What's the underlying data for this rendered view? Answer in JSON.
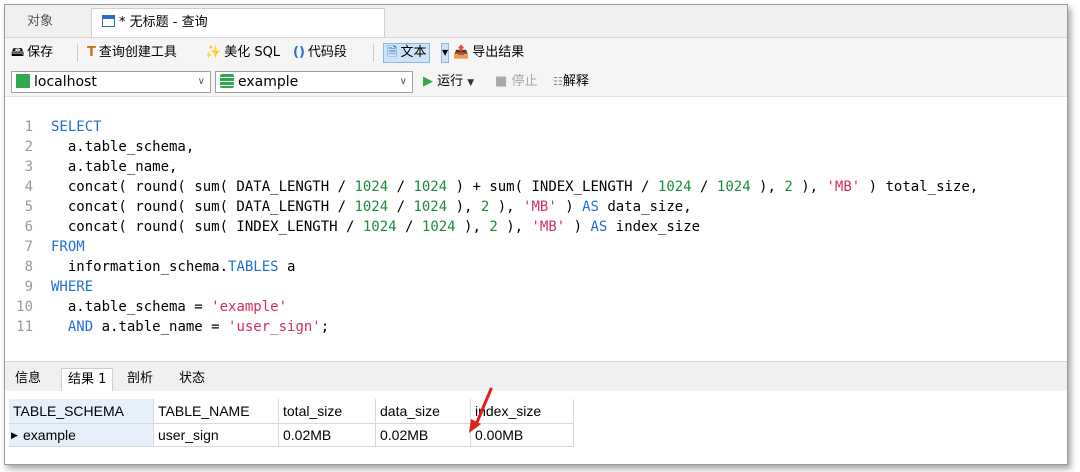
{
  "tabs": {
    "objects": "对象",
    "query": "* 无标题 - 查询"
  },
  "toolbar": {
    "save": "保存",
    "query_builder": "查询创建工具",
    "beautify": "美化 SQL",
    "snippet": "代码段",
    "text": "文本",
    "export": "导出结果"
  },
  "connection": {
    "host": "localhost",
    "database": "example",
    "run": "运行",
    "stop": "停止",
    "explain": "解释"
  },
  "editor": {
    "lines": [
      {
        "n": "1"
      },
      {
        "n": "2"
      },
      {
        "n": "3"
      },
      {
        "n": "4"
      },
      {
        "n": "5"
      },
      {
        "n": "6"
      },
      {
        "n": "7"
      },
      {
        "n": "8"
      },
      {
        "n": "9"
      },
      {
        "n": "10"
      },
      {
        "n": "11"
      }
    ],
    "t": {
      "select": "SELECT",
      "l2": "  a.table_schema,",
      "l3": "  a.table_name,",
      "l4a": "  concat( round( sum( DATA_LENGTH / ",
      "n1024": "1024",
      "div": " / ",
      "l4b": " ) + sum( INDEX_LENGTH / ",
      "l4c": " ), ",
      "n2": "2",
      "l4d": " ), ",
      "mb": "'MB'",
      "l4e": " ) total_size,",
      "l5a": "  concat( round( sum( DATA_LENGTH / ",
      "l5b": " ), ",
      "l5c": " ), ",
      "l5d": " ) ",
      "as": "AS",
      "l5e": " data_size,",
      "l6a": "  concat( round( sum( INDEX_LENGTH / ",
      "l6e": " index_size",
      "from": "FROM",
      "l8a": "  information_schema.",
      "tables": "TABLES",
      "l8b": " a",
      "where": "WHERE",
      "l10a": "  a.table_schema = ",
      "example": "'example'",
      "l11a": "  ",
      "and": "AND",
      "l11b": " a.table_name = ",
      "usersign": "'user_sign'",
      "l11c": ";"
    }
  },
  "result_tabs": {
    "info": "信息",
    "result1": "结果 1",
    "profile": "剖析",
    "status": "状态"
  },
  "grid": {
    "headers": [
      "TABLE_SCHEMA",
      "TABLE_NAME",
      "total_size",
      "data_size",
      "index_size"
    ],
    "rows": [
      [
        "example",
        "user_sign",
        "0.02MB",
        "0.02MB",
        "0.00MB"
      ]
    ]
  },
  "colors": {
    "keyword": "#1f6fd6",
    "number": "#1a8c3a",
    "string": "#d0305a",
    "annotation": "#e0201c"
  }
}
